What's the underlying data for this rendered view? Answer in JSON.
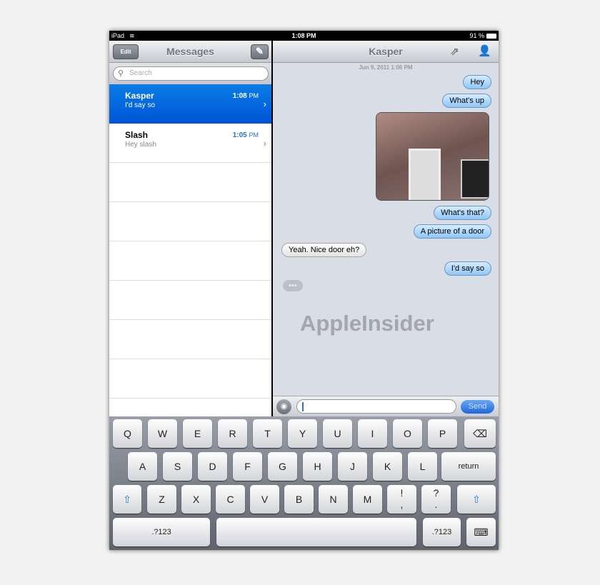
{
  "status": {
    "device": "iPad",
    "time": "1:08 PM",
    "battery": "91 %"
  },
  "left": {
    "edit": "Edit",
    "title": "Messages",
    "search_placeholder": "Search",
    "threads": [
      {
        "name": "Kasper",
        "preview": "I'd say so",
        "time": "1:08",
        "ampm": "PM",
        "selected": true
      },
      {
        "name": "Slash",
        "preview": "Hey slash",
        "time": "1:05",
        "ampm": "PM",
        "selected": false
      }
    ]
  },
  "right": {
    "title": "Kasper",
    "timestamp": "Jun 9, 2011 1:06 PM",
    "messages": [
      {
        "text": "Hey",
        "dir": "out"
      },
      {
        "text": "What's up",
        "dir": "out"
      },
      {
        "text": "[photo]",
        "dir": "out"
      },
      {
        "text": "What's that?",
        "dir": "out"
      },
      {
        "text": "A picture of a door",
        "dir": "out"
      },
      {
        "text": "Yeah. Nice door eh?",
        "dir": "in"
      },
      {
        "text": "I'd say so",
        "dir": "out"
      }
    ],
    "typing": "•••",
    "watermark": "AppleInsider",
    "input_value": "",
    "send": "Send"
  },
  "keyboard": {
    "row1": [
      "Q",
      "W",
      "E",
      "R",
      "T",
      "Y",
      "U",
      "I",
      "O",
      "P"
    ],
    "row2": [
      "A",
      "S",
      "D",
      "F",
      "G",
      "H",
      "J",
      "K",
      "L"
    ],
    "return": "return",
    "row3": [
      "Z",
      "X",
      "C",
      "V",
      "B",
      "N",
      "M",
      "!\n,",
      "?\n."
    ],
    "numbers": ".?123"
  },
  "colors": {
    "selected": "#0a6ee0",
    "outgoing": "#a8d4fa",
    "send": "#2f7de8"
  }
}
